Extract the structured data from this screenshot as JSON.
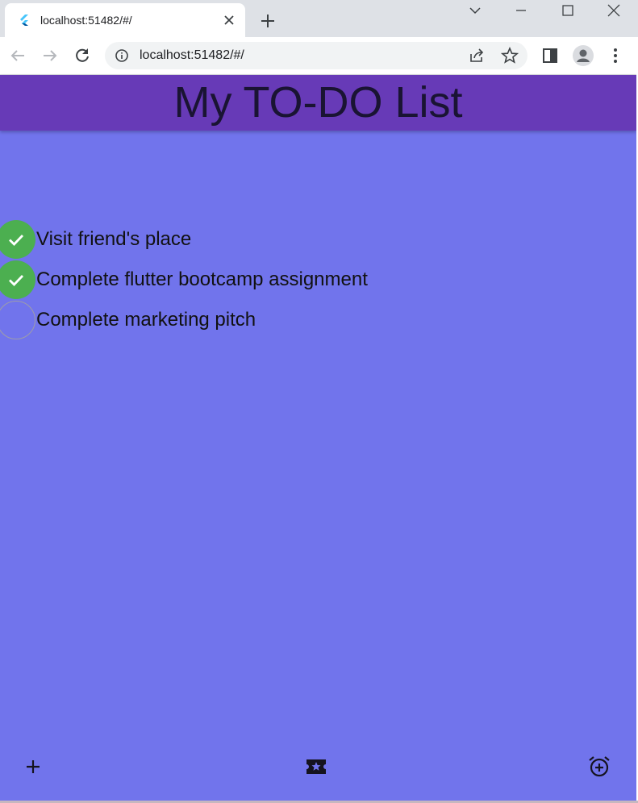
{
  "browser": {
    "tab": {
      "title": "localhost:51482/#/",
      "favicon": "flutter-logo-icon",
      "close_icon": "close-icon"
    },
    "new_tab_icon": "plus-icon",
    "window_controls": [
      "chevron-down-icon",
      "minimize-icon",
      "maximize-icon",
      "close-icon"
    ],
    "toolbar": {
      "back_icon": "back-arrow-icon",
      "forward_icon": "forward-arrow-icon",
      "reload_icon": "reload-icon",
      "url": "localhost:51482/#/",
      "site_info_icon": "info-icon",
      "share_icon": "share-icon",
      "bookmark_icon": "star-icon",
      "side_panel_icon": "side-panel-icon",
      "profile_icon": "profile-avatar-icon",
      "menu_icon": "kebab-menu-icon"
    }
  },
  "app": {
    "title": "My TO-DO List",
    "colors": {
      "background": "#7174ec",
      "appbar": "#673ab7",
      "done_check": "#4caf50"
    },
    "todos": [
      {
        "text": "Visit friend's place",
        "done": true
      },
      {
        "text": "Complete flutter bootcamp assignment",
        "done": true
      },
      {
        "text": "Complete marketing pitch",
        "done": false
      }
    ],
    "bottom_bar": {
      "left_icon": "add-icon",
      "center_icon": "ticket-star-icon",
      "right_icon": "alarm-add-icon"
    }
  }
}
